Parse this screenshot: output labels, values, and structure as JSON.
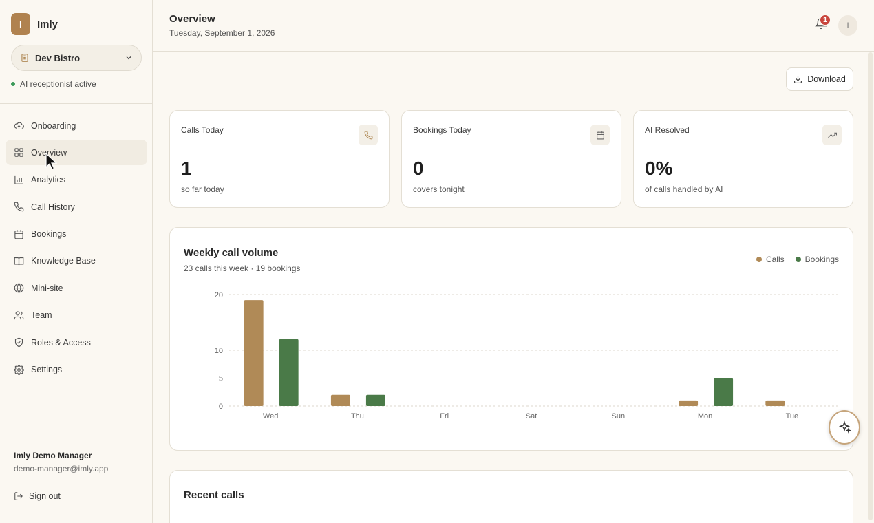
{
  "sidebar": {
    "brand_initial": "I",
    "brand_name": "Imly",
    "venue": "Dev Bistro",
    "status": "AI receptionist active",
    "items": [
      {
        "label": "Onboarding",
        "icon": "cloud-upload-icon"
      },
      {
        "label": "Overview",
        "icon": "grid-icon"
      },
      {
        "label": "Analytics",
        "icon": "bar-chart-icon"
      },
      {
        "label": "Call History",
        "icon": "phone-icon"
      },
      {
        "label": "Bookings",
        "icon": "calendar-icon"
      },
      {
        "label": "Knowledge Base",
        "icon": "book-icon"
      },
      {
        "label": "Mini-site",
        "icon": "globe-icon"
      },
      {
        "label": "Team",
        "icon": "users-icon"
      },
      {
        "label": "Roles & Access",
        "icon": "shield-icon"
      },
      {
        "label": "Settings",
        "icon": "gear-icon"
      }
    ],
    "active_item": "Overview",
    "user_name": "Imly Demo Manager",
    "user_email": "demo-manager@imly.app",
    "signout": "Sign out"
  },
  "header": {
    "title": "Overview",
    "date": "Tuesday, September 1, 2026",
    "notification_count": "1",
    "avatar_initial": "I"
  },
  "download_label": "Download",
  "stats": [
    {
      "label": "Calls Today",
      "value": "1",
      "sub": "so far today",
      "icon": "phone-icon"
    },
    {
      "label": "Bookings Today",
      "value": "0",
      "sub": "covers tonight",
      "icon": "calendar-icon"
    },
    {
      "label": "AI Resolved",
      "value": "0%",
      "sub": "of calls handled by AI",
      "icon": "trending-up-icon"
    }
  ],
  "chart": {
    "title": "Weekly call volume",
    "subtitle": "23 calls this week · 19 bookings"
  },
  "chart_data": {
    "type": "bar",
    "categories": [
      "Wed",
      "Thu",
      "Fri",
      "Sat",
      "Sun",
      "Mon",
      "Tue"
    ],
    "series": [
      {
        "name": "Calls",
        "values": [
          19,
          2,
          0,
          0,
          0,
          1,
          1
        ],
        "color": "#b08a57"
      },
      {
        "name": "Bookings",
        "values": [
          12,
          2,
          0,
          0,
          0,
          5,
          0
        ],
        "color": "#4a7a48"
      }
    ],
    "yticks": [
      0,
      5,
      10,
      20
    ],
    "ylim": [
      0,
      20
    ],
    "grid": true,
    "legend": "top-right"
  },
  "recent": {
    "title": "Recent calls"
  },
  "colors": {
    "accent": "#b0824f",
    "status_green": "#3c9a5a",
    "badge_red": "#c9463d"
  }
}
